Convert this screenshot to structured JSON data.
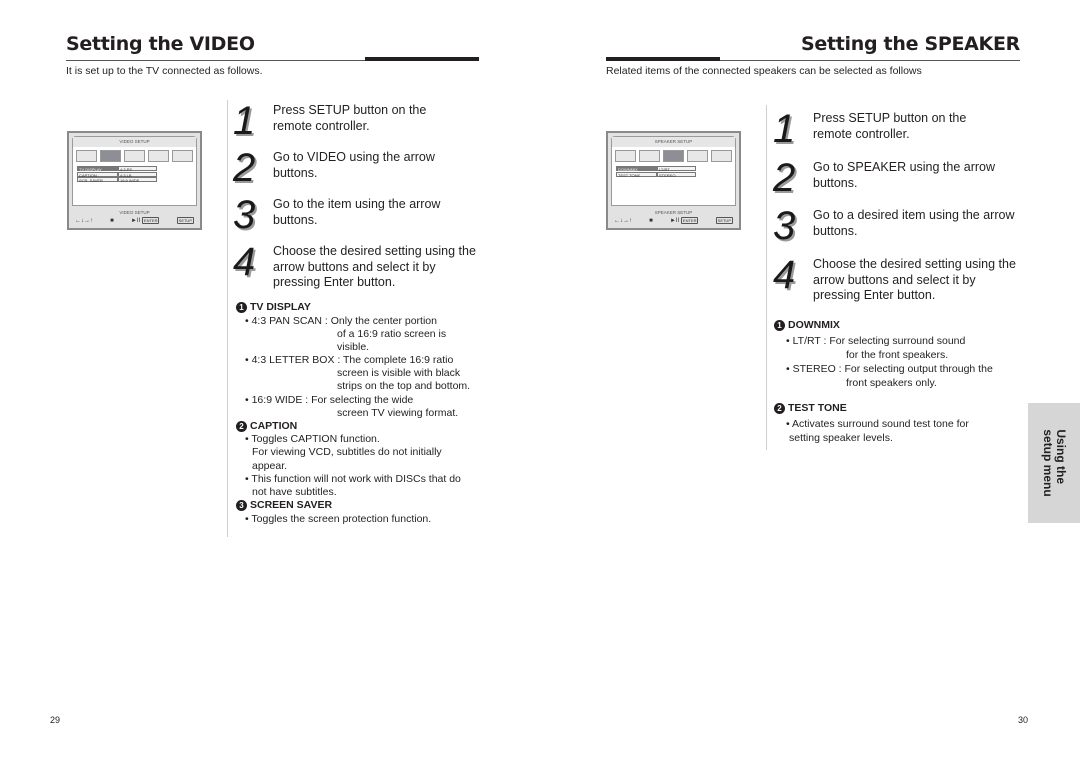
{
  "left_page": {
    "title": "Setting the VIDEO",
    "subtitle": "It is set up to the TV connected as follows.",
    "page_number": "29",
    "screen": {
      "header": "VIDEO SETUP",
      "tabs_count": 5,
      "active_tab_index": 1,
      "rows": [
        {
          "label": "TV DISPLAY",
          "value": "4:3 PS",
          "active": true
        },
        {
          "label": "CAPTION",
          "value": "4:3 LB",
          "active": false
        },
        {
          "label": "SCR. SAVER",
          "value": "16:9 WIDE",
          "active": false
        }
      ],
      "footer_label": "VIDEO SETUP",
      "footer_controls": {
        "arrows": "←↓→↑",
        "stop": "■",
        "play": "►II",
        "enter": "ENTER",
        "setup": "SETUP"
      }
    },
    "steps": [
      {
        "num": "1",
        "lines": [
          "Press SETUP button on the",
          "remote controller."
        ]
      },
      {
        "num": "2",
        "lines": [
          "Go to VIDEO using the arrow",
          "buttons."
        ]
      },
      {
        "num": "3",
        "lines": [
          "Go to the item using the arrow",
          "buttons."
        ]
      },
      {
        "num": "4",
        "lines": [
          "Choose the desired setting using the",
          "arrow buttons and select it by",
          "pressing Enter button."
        ]
      }
    ],
    "notes": [
      {
        "marker": "1",
        "heading": "TV DISPLAY",
        "lines": [
          "• 4:3 PAN SCAN :  Only the center portion",
          "of a 16:9 ratio screen is",
          "visible.",
          "• 4:3 LETTER BOX : The complete 16:9 ratio",
          "screen is visible with black",
          "strips on the top and bottom.",
          "• 16:9 WIDE :        For selecting the wide",
          "screen TV viewing format."
        ]
      },
      {
        "marker": "2",
        "heading": "CAPTION",
        "lines": [
          "• Toggles CAPTION function.",
          "For viewing VCD, subtitles do not initially",
          "appear.",
          "• This function will not work with DISCs that do",
          "not have subtitles."
        ]
      },
      {
        "marker": "3",
        "heading": "SCREEN SAVER",
        "lines": [
          "• Toggles the screen protection function."
        ]
      }
    ]
  },
  "right_page": {
    "title": "Setting the SPEAKER",
    "subtitle": "Related items of the connected speakers can be selected as follows",
    "page_number": "30",
    "screen": {
      "header": "SPEAKER SETUP",
      "tabs_count": 5,
      "active_tab_index": 2,
      "rows": [
        {
          "label": "DOWNMIX",
          "value": "LT/RT",
          "active": true
        },
        {
          "label": "TEST TONE",
          "value": "STEREO",
          "active": false
        }
      ],
      "footer_label": "SPEAKER SETUP",
      "footer_controls": {
        "arrows": "←↓→↑",
        "stop": "■",
        "play": "►II",
        "enter": "ENTER",
        "setup": "SETUP"
      }
    },
    "steps": [
      {
        "num": "1",
        "lines": [
          "Press SETUP button on the",
          "remote controller."
        ]
      },
      {
        "num": "2",
        "lines": [
          "Go to SPEAKER using the arrow",
          "buttons."
        ]
      },
      {
        "num": "3",
        "lines": [
          "Go to a desired item using the arrow",
          "buttons."
        ]
      },
      {
        "num": "4",
        "lines": [
          "Choose the desired setting using the",
          "arrow buttons and select it by",
          "pressing Enter button."
        ]
      }
    ],
    "notes": [
      {
        "marker": "1",
        "heading": "DOWNMIX",
        "lines": [
          "• LT/RT :       For selecting surround sound",
          "for the front speakers.",
          "• STEREO :  For selecting output through the",
          "front speakers only."
        ]
      },
      {
        "marker": "2",
        "heading": "TEST TONE",
        "lines": [
          "• Activates surround sound test tone for",
          "setting speaker levels."
        ]
      }
    ],
    "side_tab": [
      "Using the",
      "setup menu"
    ]
  }
}
